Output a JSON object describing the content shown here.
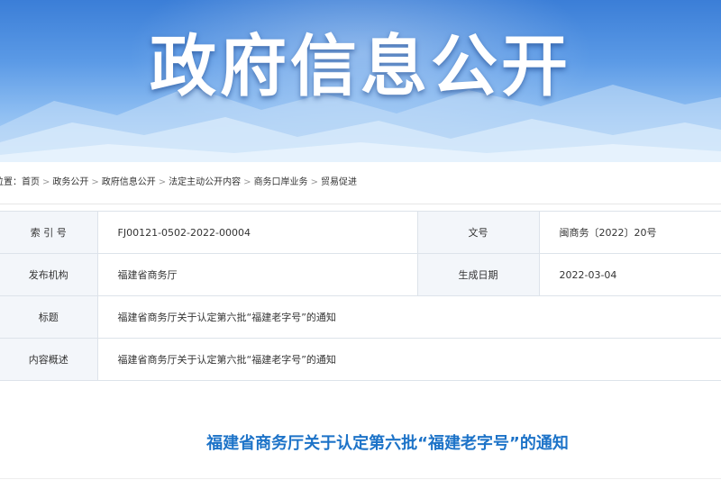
{
  "banner": {
    "title": "政府信息公开"
  },
  "breadcrumb": {
    "prefix": "位置：",
    "items": [
      "首页",
      "政务公开",
      "政府信息公开",
      "法定主动公开内容",
      "商务口岸业务",
      "贸易促进"
    ],
    "separator": ">"
  },
  "meta": {
    "index_label": "索 引 号",
    "index_value": "FJ00121-0502-2022-00004",
    "docno_label": "文号",
    "docno_value": "闽商务〔2022〕20号",
    "publisher_label": "发布机构",
    "publisher_value": "福建省商务厅",
    "date_label": "生成日期",
    "date_value": "2022-03-04",
    "title_label": "标题",
    "title_value": "福建省商务厅关于认定第六批“福建老字号”的通知",
    "summary_label": "内容概述",
    "summary_value": "福建省商务厅关于认定第六批“福建老字号”的通知"
  },
  "article": {
    "title": "福建省商务厅关于认定第六批“福建老字号”的通知"
  },
  "colors": {
    "accent": "#1d73c8",
    "label_bg": "#f3f6fa",
    "banner_top": "#3b7ed7"
  }
}
